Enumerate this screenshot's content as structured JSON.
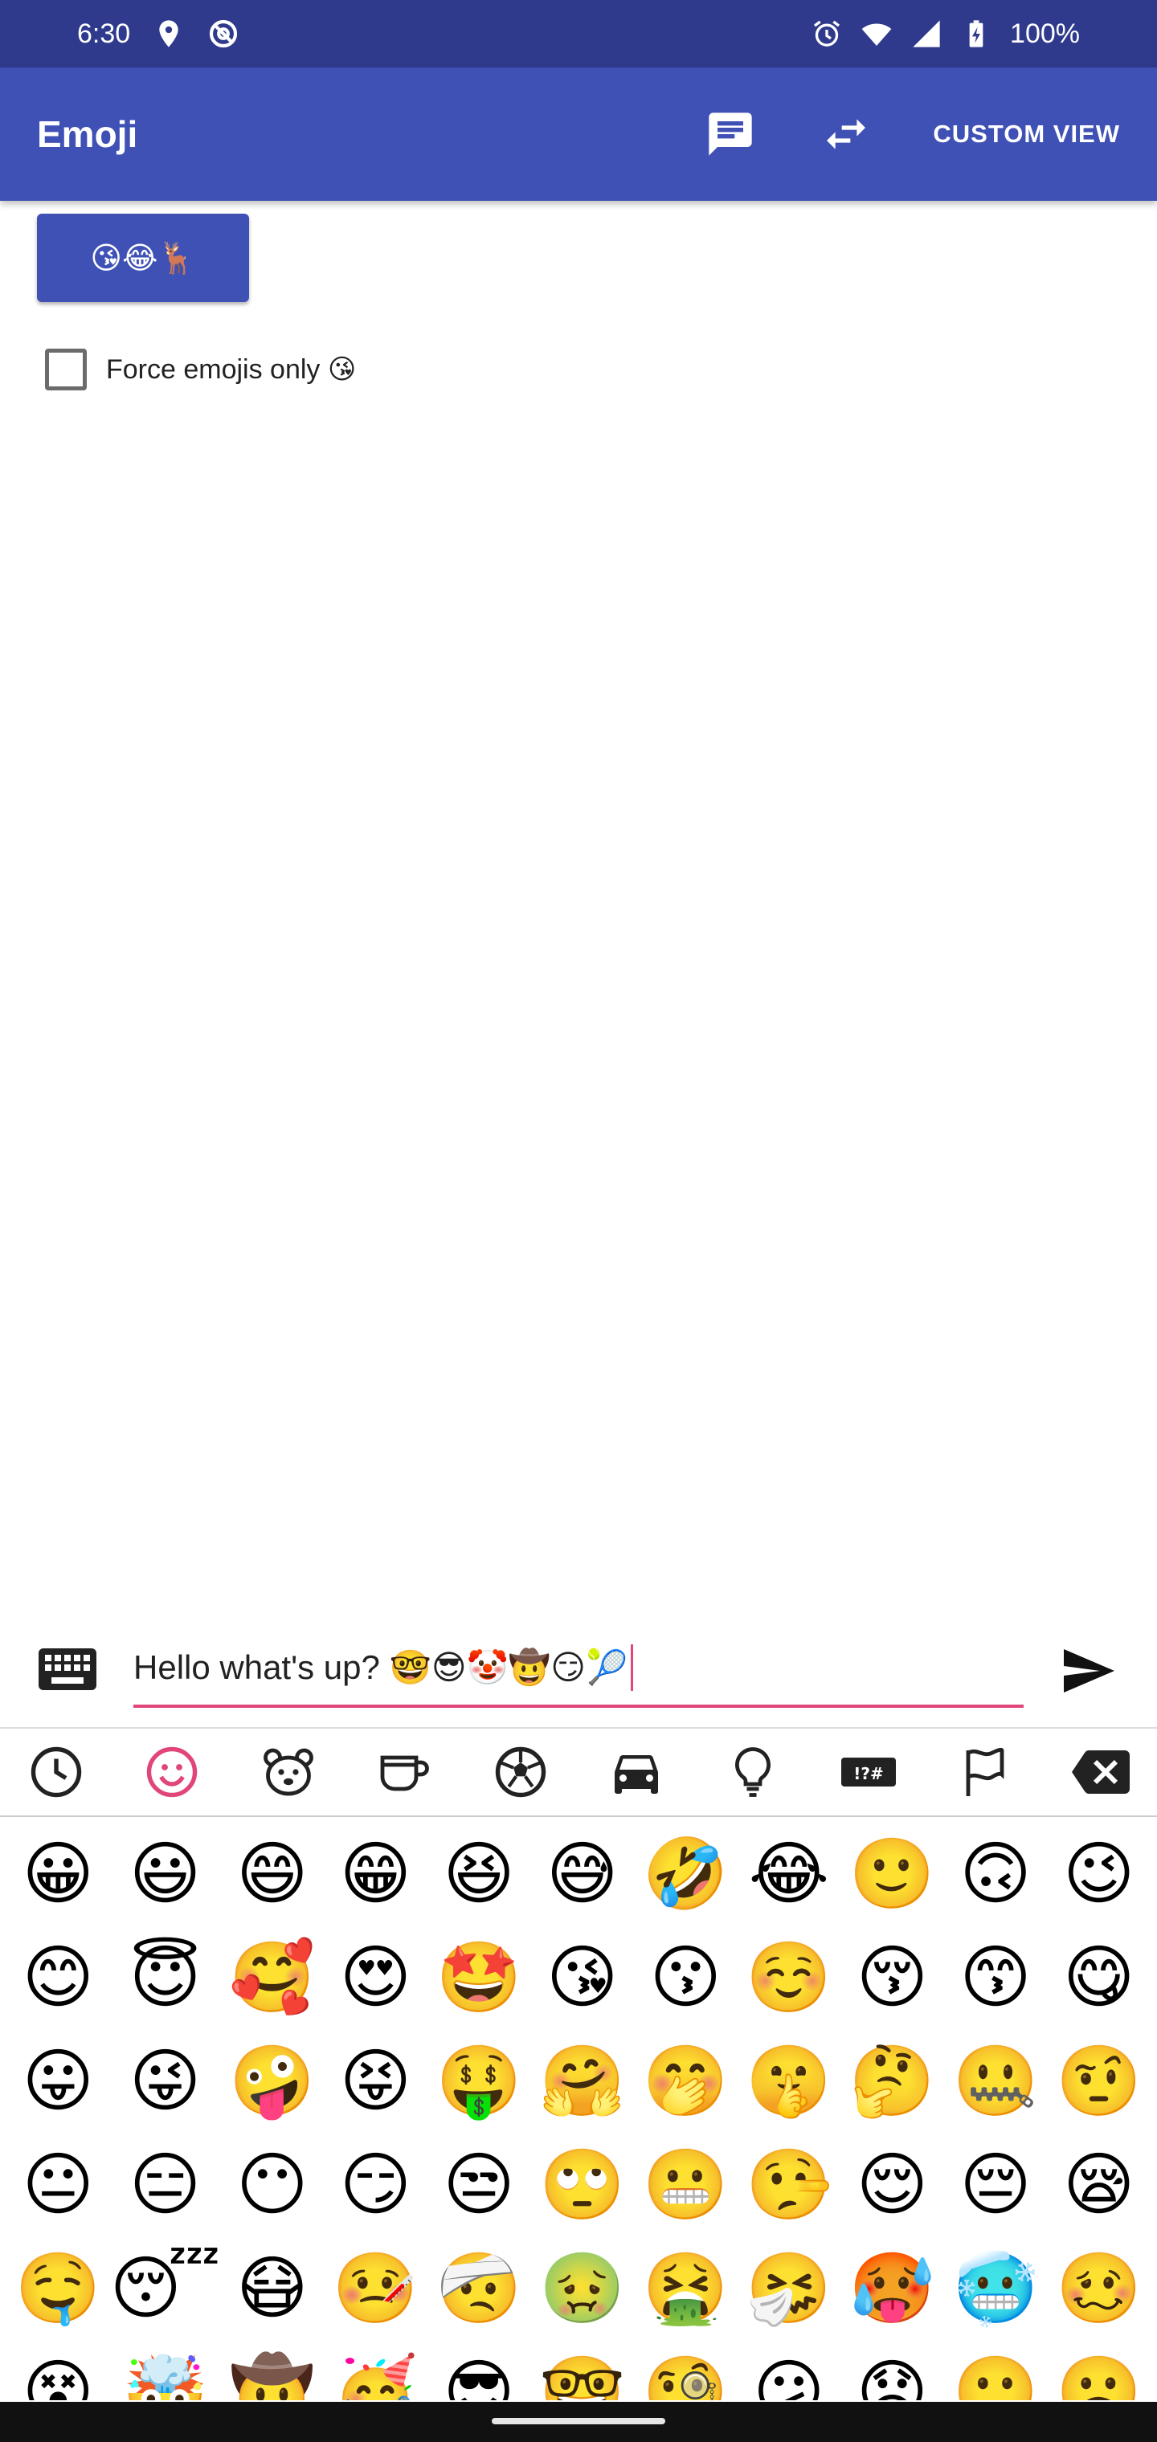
{
  "status_bar": {
    "time": "6:30",
    "battery": "100%"
  },
  "app_bar": {
    "title": "Emoji",
    "custom_view_label": "CUSTOM VIEW",
    "icons": [
      "message-icon",
      "swap-icon"
    ]
  },
  "main": {
    "emoji_button_label": "😘😂🦌",
    "force_emojis_label": "Force emojis only 😘",
    "force_emojis_checked": false
  },
  "input": {
    "value": "Hello what's up? 🤓😎🤡🤠😏🎾"
  },
  "emoji_tabs": [
    {
      "name": "recent",
      "selected": false
    },
    {
      "name": "smileys",
      "selected": true
    },
    {
      "name": "animals",
      "selected": false
    },
    {
      "name": "food",
      "selected": false
    },
    {
      "name": "activity",
      "selected": false
    },
    {
      "name": "travel",
      "selected": false
    },
    {
      "name": "objects",
      "selected": false
    },
    {
      "name": "symbols",
      "selected": false
    },
    {
      "name": "flags",
      "selected": false
    },
    {
      "name": "backspace",
      "selected": false
    }
  ],
  "emojis": [
    "😀",
    "😃",
    "😄",
    "😁",
    "😆",
    "😅",
    "🤣",
    "😂",
    "🙂",
    "🙃",
    "😉",
    "😊",
    "😇",
    "🥰",
    "😍",
    "🤩",
    "😘",
    "😗",
    "☺️",
    "😚",
    "😙",
    "😋",
    "😛",
    "😜",
    "🤪",
    "😝",
    "🤑",
    "🤗",
    "🤭",
    "🤫",
    "🤔",
    "🤐",
    "🤨",
    "😐",
    "😑",
    "😶",
    "😏",
    "😒",
    "🙄",
    "😬",
    "🤥",
    "😌",
    "😔",
    "😪",
    "🤤",
    "😴",
    "😷",
    "🤒",
    "🤕",
    "🤢",
    "🤮",
    "🤧",
    "🥵",
    "🥶",
    "🥴",
    "😵",
    "🤯",
    "🤠",
    "🥳",
    "😎",
    "🤓",
    "🧐",
    "😕",
    "😟",
    "🙁",
    "☹️"
  ],
  "colors": {
    "status_bar": "#2f3a8c",
    "primary": "#3f51b5",
    "accent": "#e0457b"
  }
}
